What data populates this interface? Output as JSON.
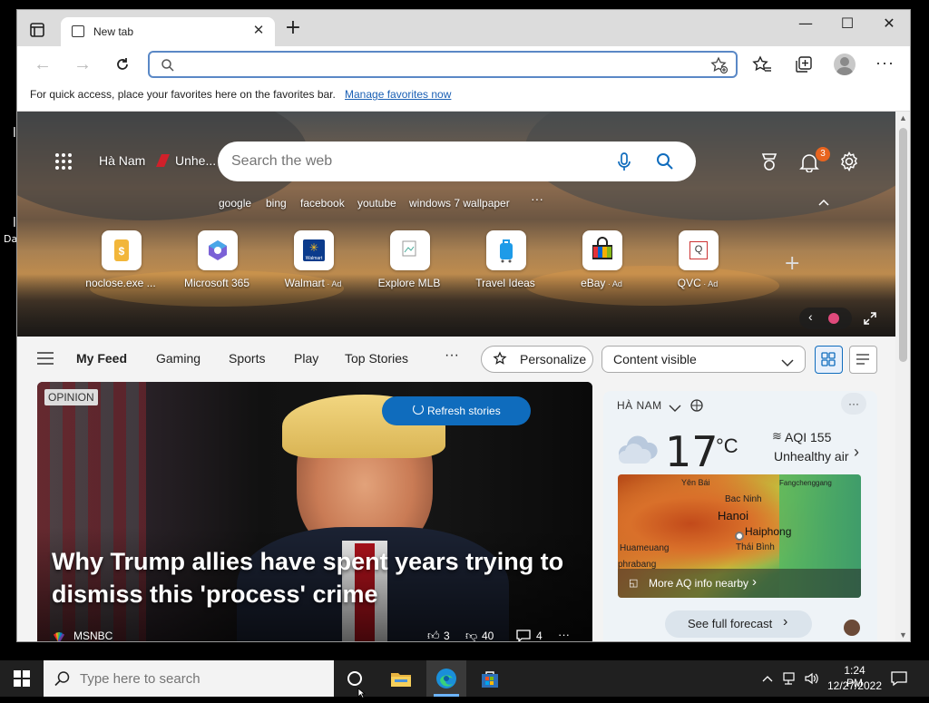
{
  "desktop": {
    "edge_text_1": "l",
    "edge_text_2": "l",
    "edge_text_3": "Da"
  },
  "browser": {
    "tab_title": "New tab",
    "new_tab_glyph": "+",
    "address_value": "",
    "favorites_bar_text": "For quick access, place your favorites here on the favorites bar.",
    "favorites_bar_link": "Manage favorites now"
  },
  "newtab": {
    "location": "Hà Nam",
    "weather_short": "Unhe...",
    "search_placeholder": "Search the web",
    "notification_count": "3",
    "quick_searches": [
      "google",
      "bing",
      "facebook",
      "youtube",
      "windows 7 wallpaper"
    ],
    "more_glyph": "···",
    "tiles": [
      {
        "label": "noclose.exe ...",
        "ad": ""
      },
      {
        "label": "Microsoft 365",
        "ad": ""
      },
      {
        "label": "Walmart",
        "ad": " · Ad"
      },
      {
        "label": "Explore MLB",
        "ad": ""
      },
      {
        "label": "Travel Ideas",
        "ad": ""
      },
      {
        "label": "eBay",
        "ad": " · Ad"
      },
      {
        "label": "QVC",
        "ad": " · Ad"
      }
    ],
    "walmart_icon_text": "Walmart",
    "qvc_icon_text": "Q"
  },
  "feed": {
    "tabs": [
      "My Feed",
      "Gaming",
      "Sports",
      "Play",
      "Top Stories"
    ],
    "more_glyph": "···",
    "personalize": "Personalize",
    "content_visibility": "Content visible"
  },
  "story": {
    "badge": "OPINION",
    "refresh": "Refresh stories",
    "headline": "Why Trump allies have spent years trying to dismiss this 'process' crime",
    "source": "MSNBC",
    "likes": "3",
    "dislikes": "40",
    "comments": "4",
    "more_glyph": "···"
  },
  "weather": {
    "location": "HÀ NAM",
    "temperature": "17",
    "unit": "°C",
    "aqi": "AQI 155",
    "aqi_status": "Unhealthy air",
    "map_labels": [
      "Yên Bái",
      "Fangchenggang",
      "Bac Ninh",
      "Hanoi",
      "Haiphong",
      "Thái Bình",
      "Huameuang",
      "phrabang"
    ],
    "map_link": "More AQ info nearby",
    "forecast_button": "See full forecast",
    "more_glyph": "···"
  },
  "taskbar": {
    "search_placeholder": "Type here to search",
    "time": "1:24 PM",
    "date": "12/27/2022"
  },
  "colors": {
    "accent": "#0f6cbd",
    "taskbar": "#202020",
    "weather_card": "#eef3f7",
    "aqi_unhealthy": "#c00000"
  }
}
